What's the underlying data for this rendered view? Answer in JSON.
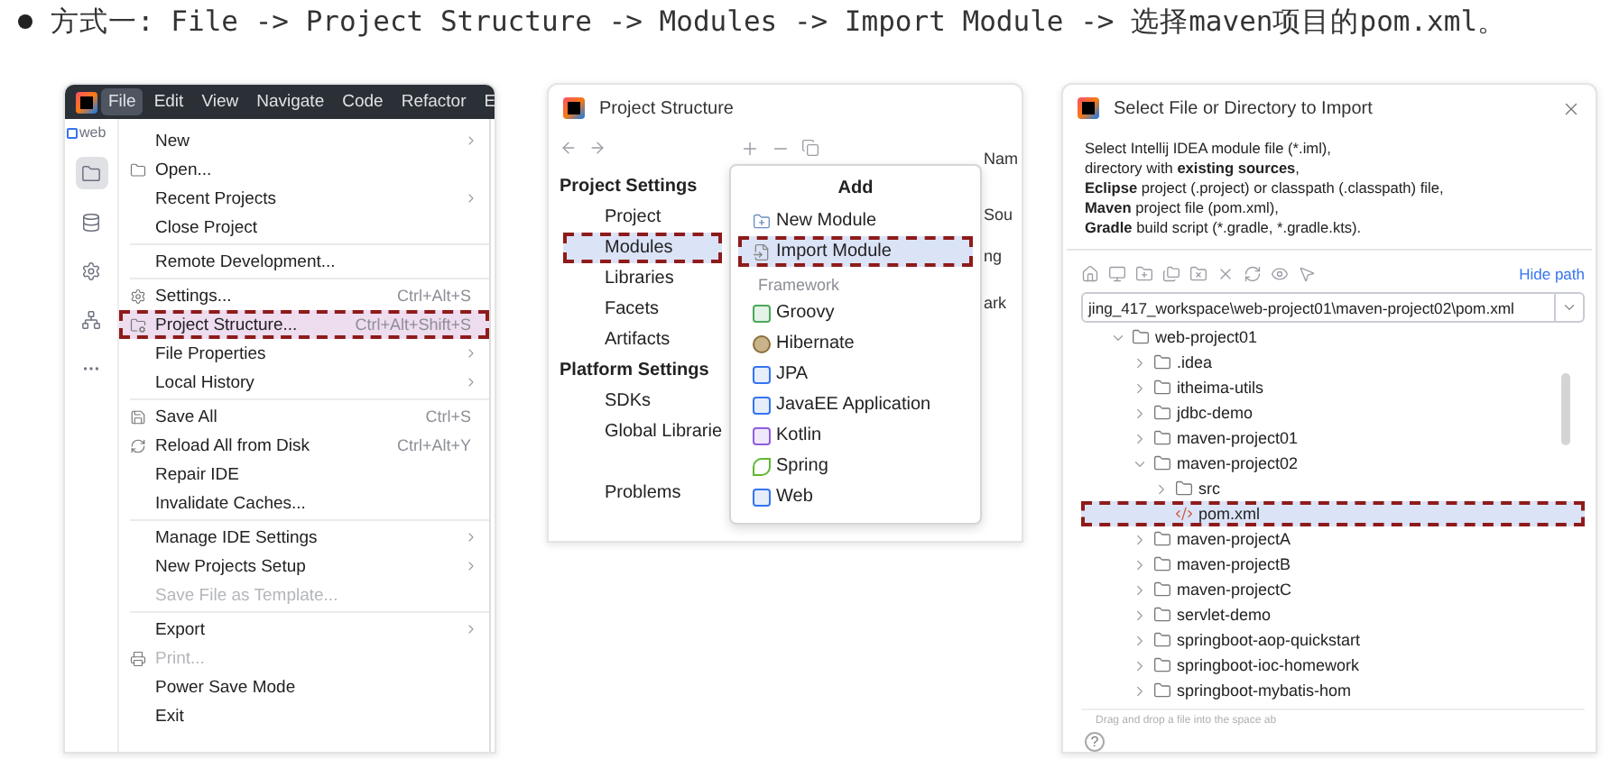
{
  "heading": {
    "text": "方式一: File -> Project Structure -> Modules -> Import Module -> 选择maven项目的pom.xml。"
  },
  "ide_menu": {
    "menubar": [
      {
        "label": "File",
        "selected": true
      },
      {
        "label": "Edit",
        "selected": false
      },
      {
        "label": "View",
        "selected": false
      },
      {
        "label": "Navigate",
        "selected": false
      },
      {
        "label": "Code",
        "selected": false
      },
      {
        "label": "Refactor",
        "selected": false
      },
      {
        "label": "E",
        "selected": false
      }
    ],
    "sidebar_label": "web",
    "items": [
      {
        "kind": "item",
        "label": "New",
        "submenu": true,
        "disabled": false,
        "selected": false
      },
      {
        "kind": "item",
        "label": "Open...",
        "submenu": false,
        "disabled": false,
        "selected": false
      },
      {
        "kind": "item",
        "label": "Recent Projects",
        "submenu": true,
        "disabled": false,
        "selected": false
      },
      {
        "kind": "item",
        "label": "Close Project",
        "submenu": false,
        "disabled": false,
        "selected": false
      },
      {
        "kind": "separator"
      },
      {
        "kind": "item",
        "label": "Remote Development...",
        "submenu": false,
        "disabled": false,
        "selected": false
      },
      {
        "kind": "separator"
      },
      {
        "kind": "item",
        "label": "Settings...",
        "shortcut": "Ctrl+Alt+S",
        "submenu": false,
        "disabled": false,
        "selected": false
      },
      {
        "kind": "item",
        "label": "Project Structure...",
        "shortcut": "Ctrl+Alt+Shift+S",
        "submenu": false,
        "disabled": false,
        "selected": true
      },
      {
        "kind": "item",
        "label": "File Properties",
        "submenu": true,
        "disabled": false,
        "selected": false
      },
      {
        "kind": "item",
        "label": "Local History",
        "submenu": true,
        "disabled": false,
        "selected": false
      },
      {
        "kind": "separator"
      },
      {
        "kind": "item",
        "label": "Save All",
        "shortcut": "Ctrl+S",
        "submenu": false,
        "disabled": false,
        "selected": false
      },
      {
        "kind": "item",
        "label": "Reload All from Disk",
        "shortcut": "Ctrl+Alt+Y",
        "submenu": false,
        "disabled": false,
        "selected": false
      },
      {
        "kind": "item",
        "label": "Repair IDE",
        "submenu": false,
        "disabled": false,
        "selected": false
      },
      {
        "kind": "item",
        "label": "Invalidate Caches...",
        "submenu": false,
        "disabled": false,
        "selected": false
      },
      {
        "kind": "separator"
      },
      {
        "kind": "item",
        "label": "Manage IDE Settings",
        "submenu": true,
        "disabled": false,
        "selected": false
      },
      {
        "kind": "item",
        "label": "New Projects Setup",
        "submenu": true,
        "disabled": false,
        "selected": false
      },
      {
        "kind": "item",
        "label": "Save File as Template...",
        "submenu": false,
        "disabled": true,
        "selected": false
      },
      {
        "kind": "separator"
      },
      {
        "kind": "item",
        "label": "Export",
        "submenu": true,
        "disabled": false,
        "selected": false
      },
      {
        "kind": "item",
        "label": "Print...",
        "submenu": false,
        "disabled": true,
        "selected": false
      },
      {
        "kind": "item",
        "label": "Power Save Mode",
        "submenu": false,
        "disabled": false,
        "selected": false
      },
      {
        "kind": "item",
        "label": "Exit",
        "submenu": false,
        "disabled": false,
        "selected": false
      }
    ]
  },
  "project_structure": {
    "title": "Project Structure",
    "sections": [
      {
        "heading": "Project Settings",
        "items": [
          {
            "label": "Project",
            "selected": false
          },
          {
            "label": "Modules",
            "selected": true
          },
          {
            "label": "Libraries",
            "selected": false
          },
          {
            "label": "Facets",
            "selected": false
          },
          {
            "label": "Artifacts",
            "selected": false
          }
        ]
      },
      {
        "heading": "Platform Settings",
        "items": [
          {
            "label": "SDKs",
            "selected": false
          },
          {
            "label": "Global Librarie",
            "selected": false
          }
        ]
      }
    ],
    "problems": "Problems",
    "add_popup": {
      "title": "Add",
      "items": [
        {
          "label": "New Module",
          "selected": false
        },
        {
          "label": "Import Module",
          "selected": true
        }
      ],
      "section": "Framework",
      "frameworks": [
        "Groovy",
        "Hibernate",
        "JPA",
        "JavaEE Application",
        "Kotlin",
        "Spring",
        "Web"
      ]
    },
    "fragments": [
      "Nam",
      "Sou",
      "ng",
      "ark"
    ]
  },
  "import_dialog": {
    "title": "Select File or Directory to Import",
    "description": [
      [
        {
          "text": "Select Intellij IDEA module file (*.iml),",
          "bold": false
        }
      ],
      [
        {
          "text": "directory with ",
          "bold": false
        },
        {
          "text": "existing sources",
          "bold": true
        },
        {
          "text": ",",
          "bold": false
        }
      ],
      [
        {
          "text": "Eclipse",
          "bold": true
        },
        {
          "text": " project (.project) or classpath (.classpath) file,",
          "bold": false
        }
      ],
      [
        {
          "text": "Maven",
          "bold": true
        },
        {
          "text": " project file (pom.xml),",
          "bold": false
        }
      ],
      [
        {
          "text": "Gradle",
          "bold": true
        },
        {
          "text": " build script (*.gradle, *.gradle.kts).",
          "bold": false
        }
      ]
    ],
    "hide_path": "Hide path",
    "path": "jing_417_workspace\\web-project01\\maven-project02\\pom.xml",
    "tree": [
      {
        "label": "web-project01",
        "kind": "folder",
        "expanded": true,
        "selected": false,
        "children": [
          {
            "label": ".idea",
            "kind": "folder",
            "expanded": false,
            "selected": false
          },
          {
            "label": "itheima-utils",
            "kind": "folder",
            "expanded": false,
            "selected": false
          },
          {
            "label": "jdbc-demo",
            "kind": "folder",
            "expanded": false,
            "selected": false
          },
          {
            "label": "maven-project01",
            "kind": "folder",
            "expanded": false,
            "selected": false
          },
          {
            "label": "maven-project02",
            "kind": "folder",
            "expanded": true,
            "selected": false,
            "children": [
              {
                "label": "src",
                "kind": "folder",
                "expanded": false,
                "selected": false
              },
              {
                "label": "pom.xml",
                "kind": "file",
                "expanded": false,
                "selected": true
              }
            ]
          },
          {
            "label": "maven-projectA",
            "kind": "folder",
            "expanded": false,
            "selected": false
          },
          {
            "label": "maven-projectB",
            "kind": "folder",
            "expanded": false,
            "selected": false
          },
          {
            "label": "maven-projectC",
            "kind": "folder",
            "expanded": false,
            "selected": false
          },
          {
            "label": "servlet-demo",
            "kind": "folder",
            "expanded": false,
            "selected": false
          },
          {
            "label": "springboot-aop-quickstart",
            "kind": "folder",
            "expanded": false,
            "selected": false
          },
          {
            "label": "springboot-ioc-homework",
            "kind": "folder",
            "expanded": false,
            "selected": false
          },
          {
            "label": "springboot-mybatis-hom",
            "kind": "folder",
            "expanded": false,
            "selected": false
          }
        ]
      }
    ],
    "hint": "Drag and drop a file into the space ab",
    "help": "?"
  }
}
